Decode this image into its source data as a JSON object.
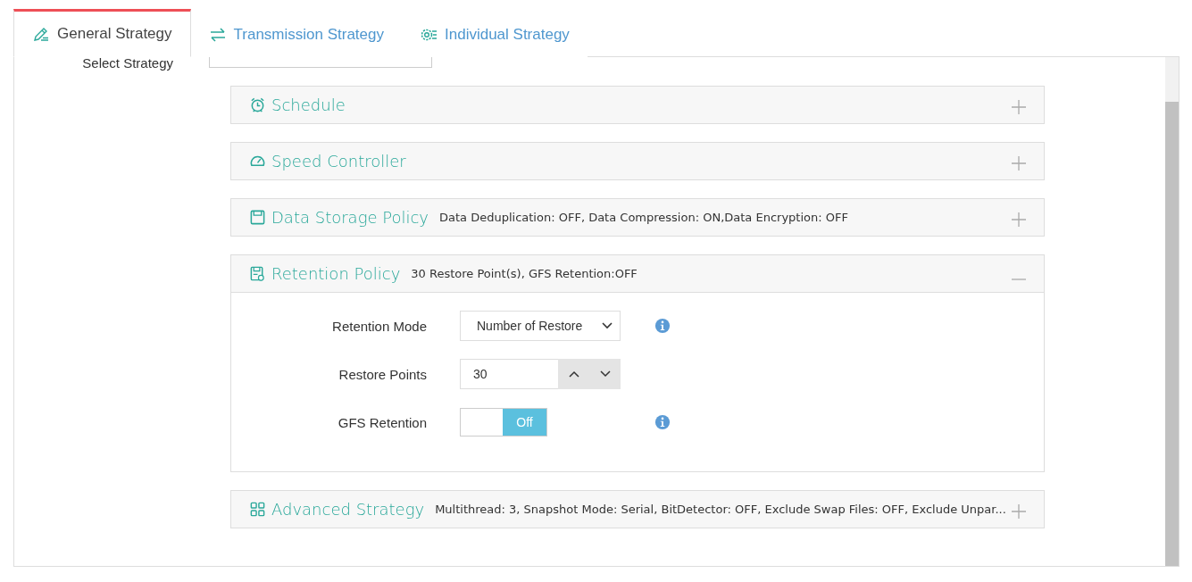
{
  "tabs": [
    {
      "label": "General Strategy",
      "selected": true
    },
    {
      "label": "Transmission Strategy",
      "selected": false
    },
    {
      "label": "Individual Strategy",
      "selected": false
    }
  ],
  "select_strategy": {
    "label": "Select Strategy"
  },
  "panels": [
    {
      "title": "Schedule",
      "expanded": false
    },
    {
      "title": "Speed Controller",
      "expanded": false
    },
    {
      "title": "Data Storage Policy",
      "summary": "Data Deduplication: OFF, Data Compression: ON,Data Encryption: OFF",
      "expanded": false
    },
    {
      "title": "Retention Policy",
      "summary": "30 Restore Point(s), GFS Retention:OFF",
      "expanded": true,
      "fields": [
        {
          "kind": "select",
          "label": "Retention Mode",
          "value": "Number of Restore",
          "info": true
        },
        {
          "kind": "stepper",
          "label": "Restore Points",
          "value": "30",
          "info": false
        },
        {
          "kind": "toggle",
          "label": "GFS Retention",
          "on": false,
          "state_label": "Off",
          "info": true
        }
      ]
    },
    {
      "title": "Advanced Strategy",
      "summary": "Multithread: 3, Snapshot Mode: Serial, BitDetector: OFF, Exclude Swap Files: OFF, Exclude Unpar...",
      "expanded": false
    }
  ]
}
